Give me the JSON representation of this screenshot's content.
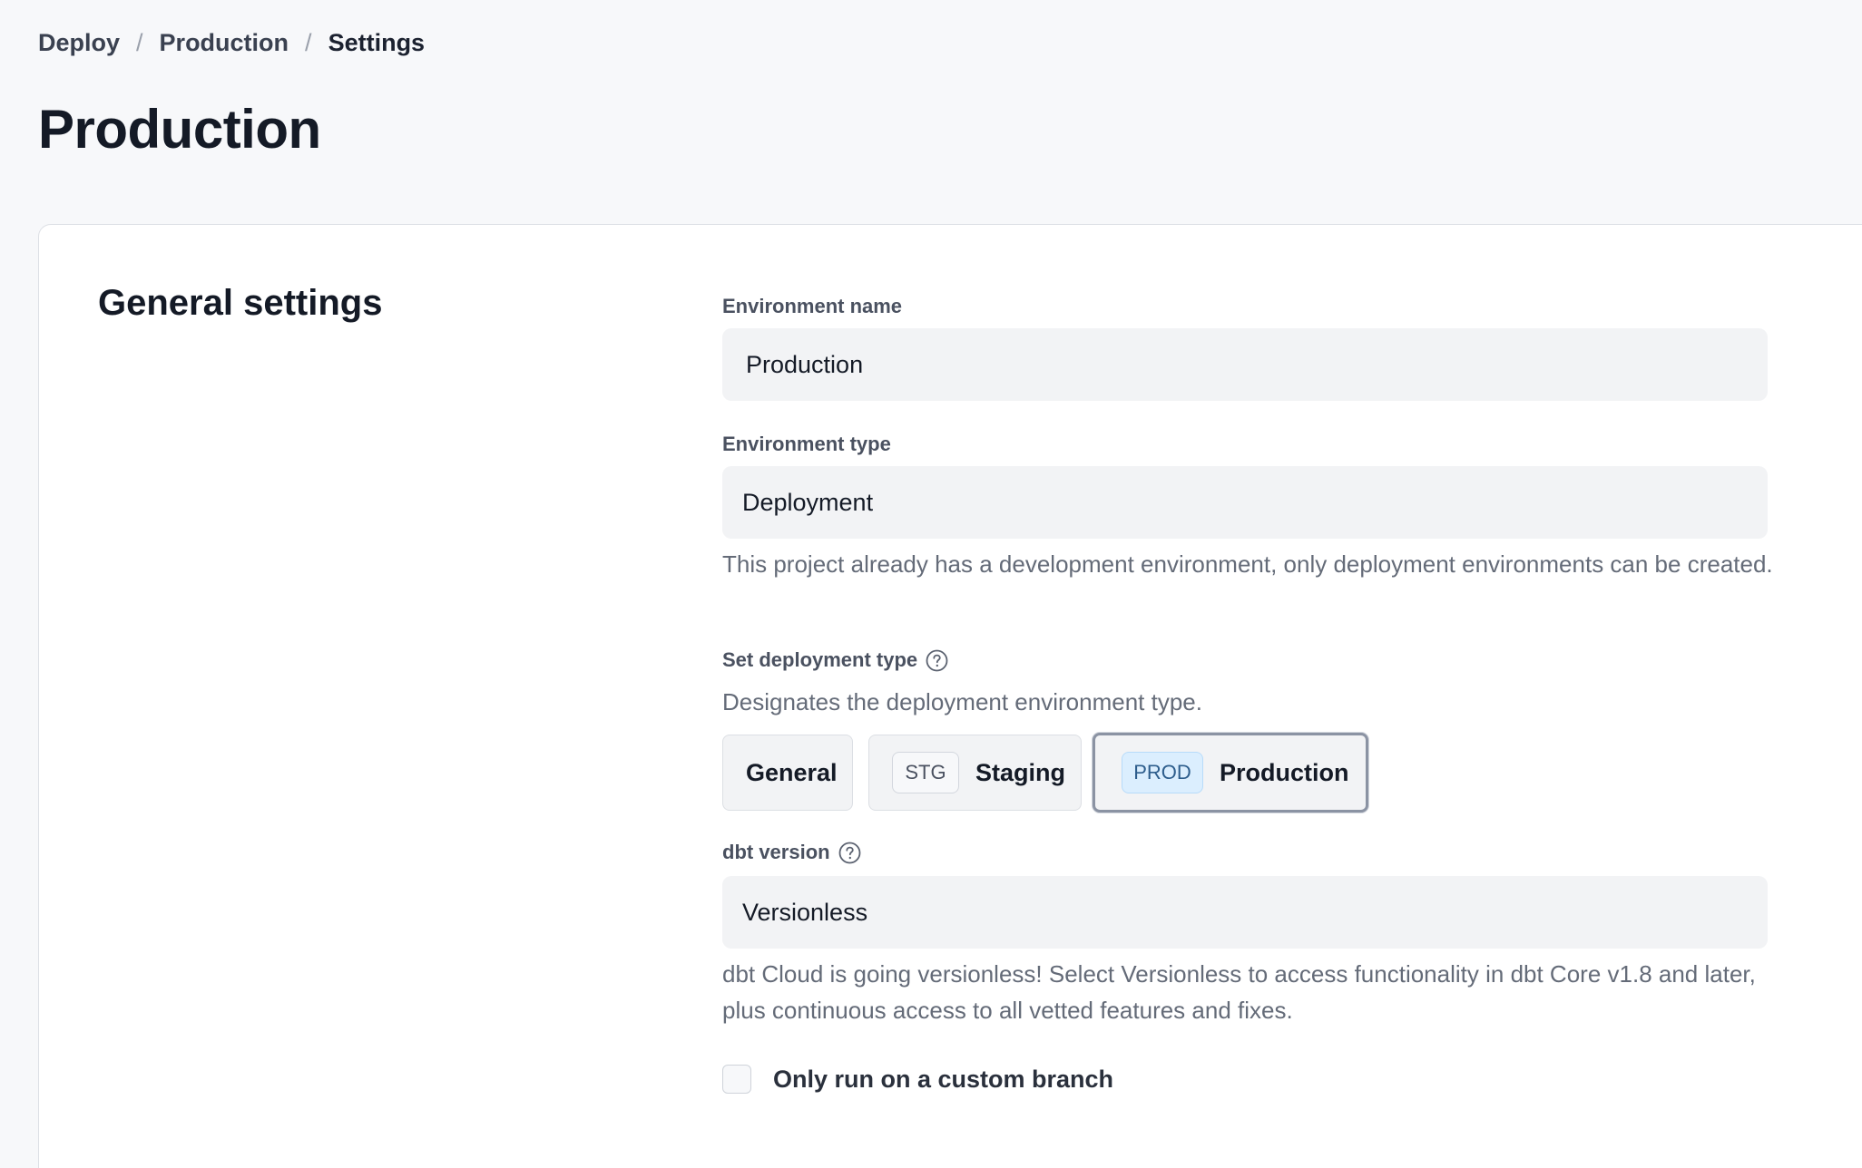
{
  "breadcrumb": {
    "items": [
      "Deploy",
      "Production",
      "Settings"
    ],
    "separator": "/"
  },
  "page": {
    "title": "Production"
  },
  "general_settings": {
    "title": "General settings",
    "environment_name": {
      "label": "Environment name",
      "value": "Production"
    },
    "environment_type": {
      "label": "Environment type",
      "value": "Deployment",
      "helper": "This project already has a development environment, only deployment environments can be created."
    },
    "deployment_type": {
      "label": "Set deployment type",
      "icon": "help-circle-icon",
      "helper": "Designates the deployment environment type.",
      "options": [
        {
          "label": "General",
          "badge": ""
        },
        {
          "label": "Staging",
          "badge": "STG"
        },
        {
          "label": "Production",
          "badge": "PROD"
        }
      ],
      "selected": "Production"
    },
    "dbt_version": {
      "label": "dbt version",
      "icon": "help-circle-icon",
      "value": "Versionless",
      "helper": "dbt Cloud is going versionless! Select Versionless to access functionality in dbt Core v1.8 and later, plus continuous access to all vetted features and fixes."
    },
    "custom_branch": {
      "label": "Only run on a custom branch",
      "checked": false
    }
  },
  "colors": {
    "background": "#f7f8fa",
    "card": "#ffffff",
    "input": "#f2f3f5",
    "prod_badge": "#dbeefe",
    "selected_border": "#8b93a3"
  }
}
